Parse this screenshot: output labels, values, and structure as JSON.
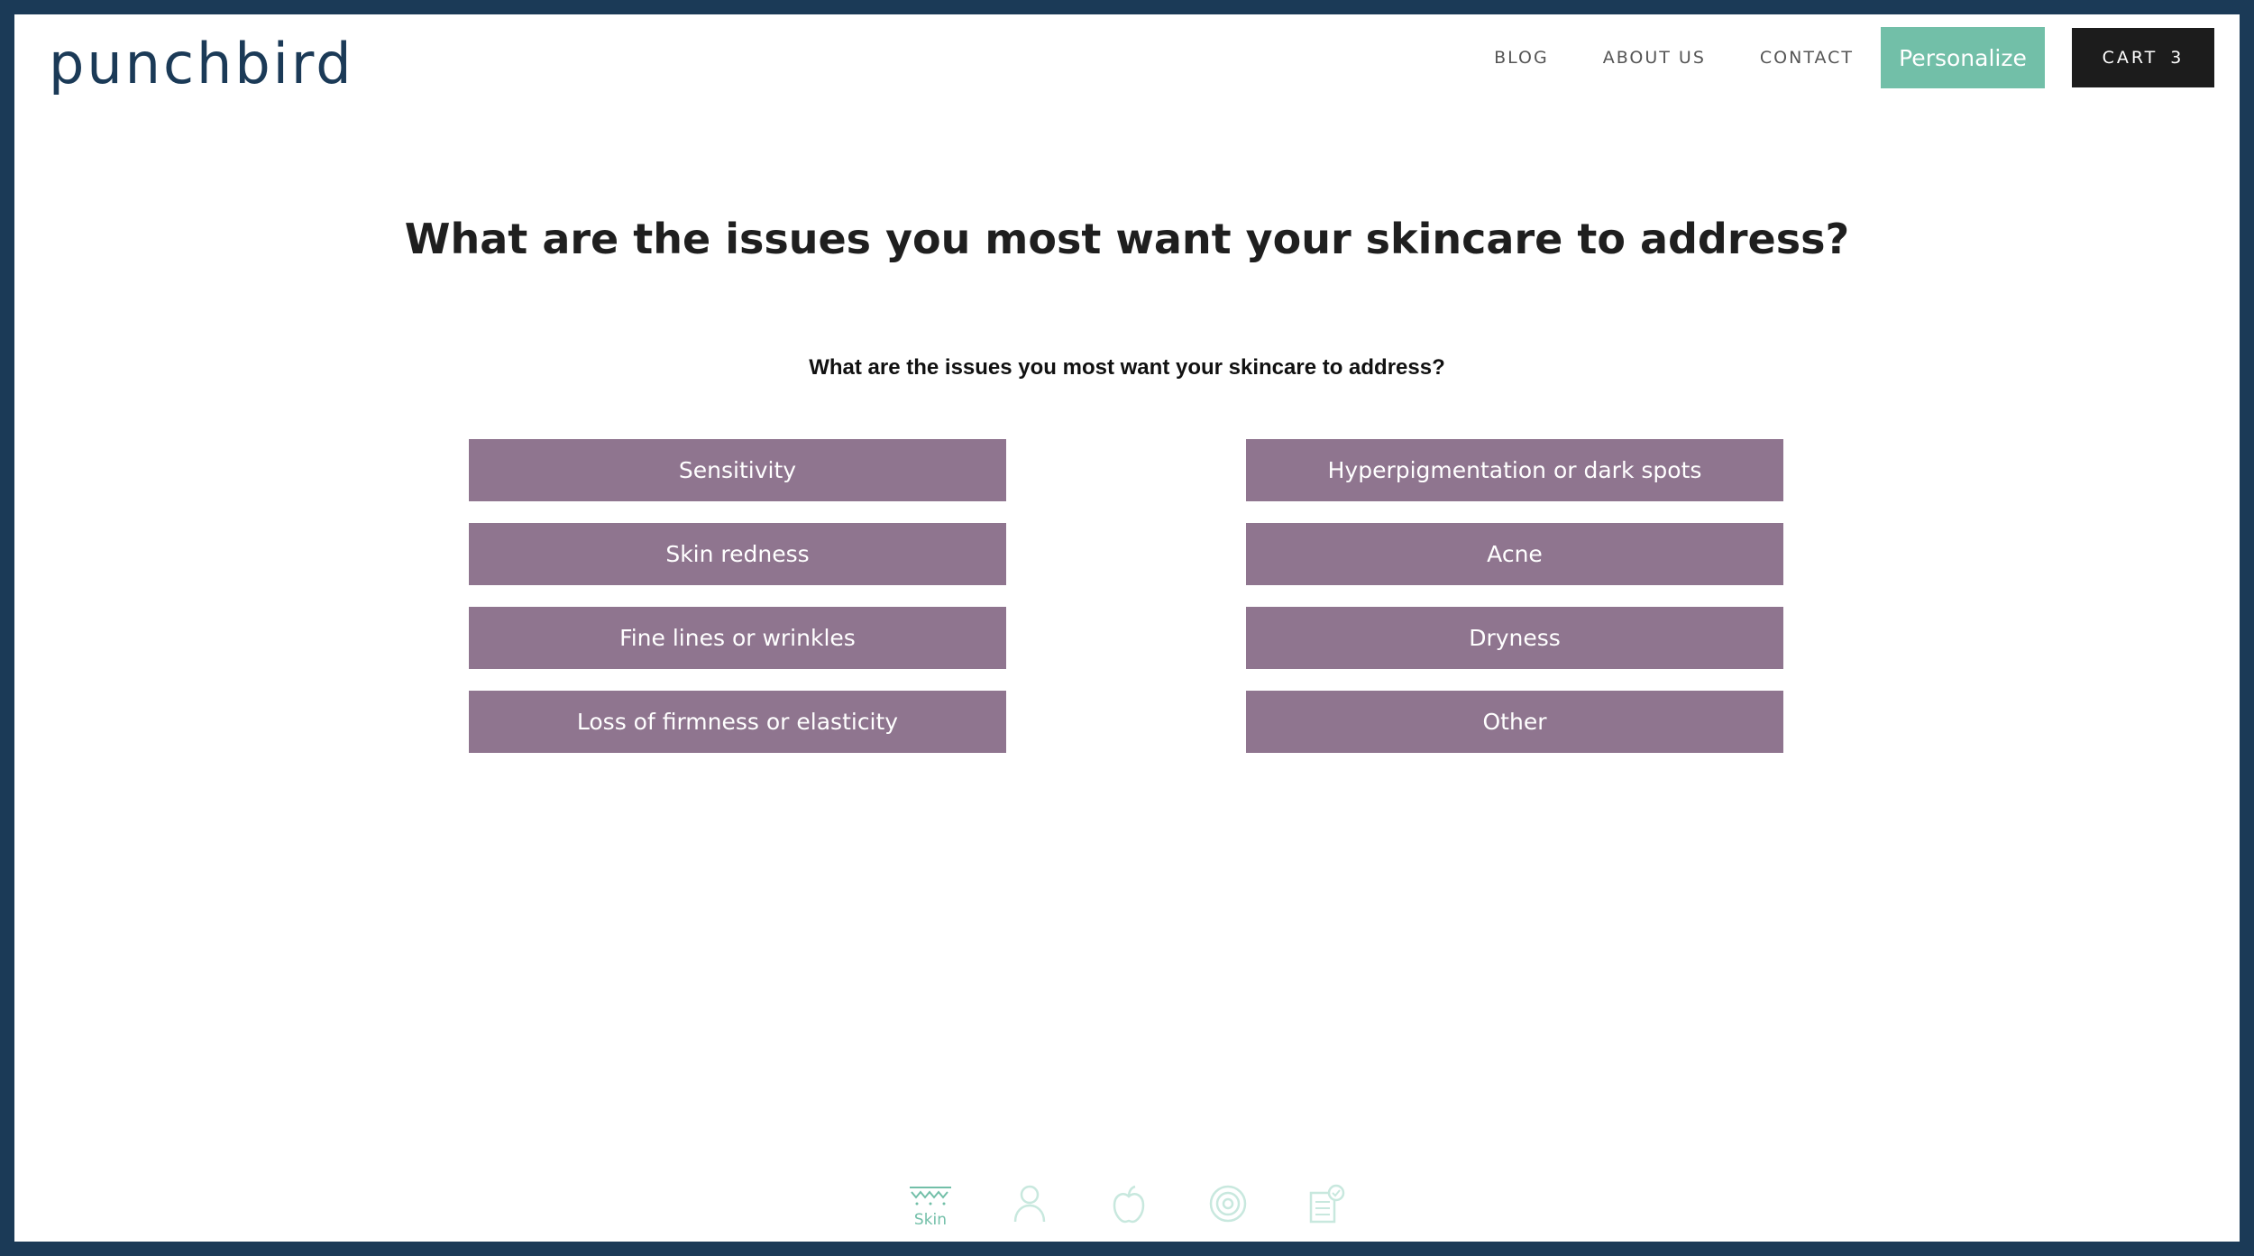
{
  "header": {
    "logo": "punchbird",
    "nav": {
      "blog": "BLOG",
      "about": "ABOUT US",
      "contact": "CONTACT"
    },
    "personalize_label": "Personalize",
    "cart_label": "CART",
    "cart_count": "3"
  },
  "quiz": {
    "title": "What are the issues you most want your skincare to address?",
    "subtitle": "What are the issues you most want your skincare to address?",
    "options": [
      "Sensitivity",
      "Hyperpigmentation or dark spots",
      "Skin redness",
      "Acne",
      "Fine lines or wrinkles",
      "Dryness",
      "Loss of firmness or elasticity",
      "Other"
    ]
  },
  "steps": [
    {
      "icon": "skin-icon",
      "label": "Skin",
      "active": true
    },
    {
      "icon": "person-icon",
      "label": "",
      "active": false
    },
    {
      "icon": "apple-icon",
      "label": "",
      "active": false
    },
    {
      "icon": "target-icon",
      "label": "",
      "active": false
    },
    {
      "icon": "clipboard-check-icon",
      "label": "",
      "active": false
    }
  ],
  "colors": {
    "border": "#1b3a57",
    "logo": "#1b3a57",
    "option_bg": "#8f758f",
    "personalize_bg": "#72bfa8",
    "cart_bg": "#1c1c1c",
    "step_active": "#72bfa8",
    "step_inactive": "#c8e8de"
  }
}
